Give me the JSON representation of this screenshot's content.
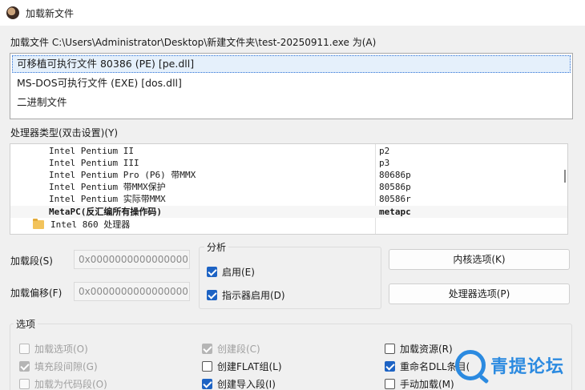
{
  "window": {
    "title": "加载新文件"
  },
  "load_file_label": "加载文件 C:\\Users\\Administrator\\Desktop\\新建文件夹\\test-20250911.exe 为(A)",
  "file_types": [
    {
      "label": "可移植可执行文件 80386 (PE) [pe.dll]",
      "selected": true
    },
    {
      "label": "MS-DOS可执行文件 (EXE) [dos.dll]",
      "selected": false
    },
    {
      "label": "二进制文件",
      "selected": false
    }
  ],
  "processor_label": "处理器类型(双击设置)(Y)",
  "processors": [
    {
      "name": "Intel Pentium II",
      "code": "p2"
    },
    {
      "name": "Intel Pentium III",
      "code": "p3"
    },
    {
      "name": "Intel Pentium Pro (P6) 带MMX",
      "code": "80686p"
    },
    {
      "name": "Intel Pentium 带MMX保护",
      "code": "80586p"
    },
    {
      "name": "Intel Pentium 实际带MMX",
      "code": "80586r"
    },
    {
      "name": "MetaPC(反汇编所有操作码)",
      "code": "metapc"
    },
    {
      "name": "Intel 860 处理器",
      "code": ""
    }
  ],
  "load_segment": {
    "label": "加载段(S)",
    "value": "0x0000000000000000"
  },
  "load_offset": {
    "label": "加载偏移(F)",
    "value": "0x0000000000000000"
  },
  "analysis": {
    "title": "分析",
    "enabled": {
      "label": "启用(E)",
      "checked": true
    },
    "indicator": {
      "label": "指示器启用(D)",
      "checked": true
    }
  },
  "buttons": {
    "kernel_options": "内核选项(K)",
    "processor_options": "处理器选项(P)"
  },
  "options": {
    "title": "选项",
    "load_options": {
      "label": "加载选项(O)",
      "checked": false
    },
    "fill_gaps": {
      "label": "填充段间隙(G)",
      "checked": true
    },
    "load_as_code": {
      "label": "加载为代码段(O)",
      "checked": false
    },
    "create_segments": {
      "label": "创建段(C)",
      "checked": true
    },
    "create_flat": {
      "label": "创建FLAT组(L)",
      "checked": false
    },
    "create_imports": {
      "label": "创建导入段(I)",
      "checked": true
    },
    "load_resources": {
      "label": "加载资源(R)",
      "checked": false
    },
    "rename_dll": {
      "label": "重命名DLL条目(",
      "checked": true
    },
    "manual_load": {
      "label": "手动加载(M)",
      "checked": false
    }
  },
  "watermark": {
    "text": "青提论坛"
  },
  "colors": {
    "accent": "#1d63c4",
    "selection_border": "#2a6fd6",
    "watermark": "#2b8ae0"
  }
}
